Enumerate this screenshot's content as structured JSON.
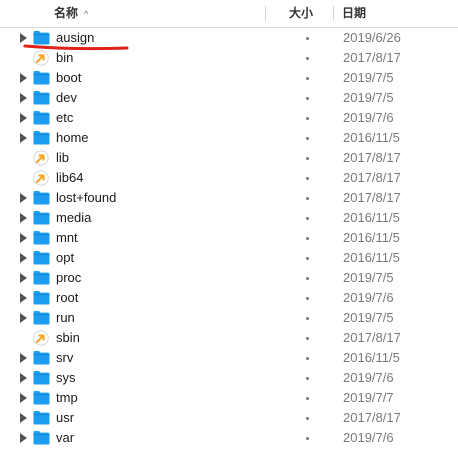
{
  "columns": {
    "name": "名称",
    "size": "大小",
    "date": "日期"
  },
  "rows": [
    {
      "name": "ausign",
      "type": "folder",
      "size": "•",
      "date": "2019/6/26"
    },
    {
      "name": "bin",
      "type": "link",
      "size": "•",
      "date": "2017/8/17"
    },
    {
      "name": "boot",
      "type": "folder",
      "size": "•",
      "date": "2019/7/5"
    },
    {
      "name": "dev",
      "type": "folder",
      "size": "•",
      "date": "2019/7/5"
    },
    {
      "name": "etc",
      "type": "folder",
      "size": "•",
      "date": "2019/7/6"
    },
    {
      "name": "home",
      "type": "folder",
      "size": "•",
      "date": "2016/11/5"
    },
    {
      "name": "lib",
      "type": "link",
      "size": "•",
      "date": "2017/8/17"
    },
    {
      "name": "lib64",
      "type": "link",
      "size": "•",
      "date": "2017/8/17"
    },
    {
      "name": "lost+found",
      "type": "folder",
      "size": "•",
      "date": "2017/8/17"
    },
    {
      "name": "media",
      "type": "folder",
      "size": "•",
      "date": "2016/11/5"
    },
    {
      "name": "mnt",
      "type": "folder",
      "size": "•",
      "date": "2016/11/5"
    },
    {
      "name": "opt",
      "type": "folder",
      "size": "•",
      "date": "2016/11/5"
    },
    {
      "name": "proc",
      "type": "folder",
      "size": "•",
      "date": "2019/7/5"
    },
    {
      "name": "root",
      "type": "folder",
      "size": "•",
      "date": "2019/7/6"
    },
    {
      "name": "run",
      "type": "folder",
      "size": "•",
      "date": "2019/7/5"
    },
    {
      "name": "sbin",
      "type": "link",
      "size": "•",
      "date": "2017/8/17"
    },
    {
      "name": "srv",
      "type": "folder",
      "size": "•",
      "date": "2016/11/5"
    },
    {
      "name": "sys",
      "type": "folder",
      "size": "•",
      "date": "2019/7/6"
    },
    {
      "name": "tmp",
      "type": "folder",
      "size": "•",
      "date": "2019/7/7"
    },
    {
      "name": "usr",
      "type": "folder",
      "size": "•",
      "date": "2017/8/17"
    },
    {
      "name": "var",
      "type": "folder",
      "size": "•",
      "date": "2019/7/6"
    }
  ],
  "colors": {
    "folder": "#1b9ef0",
    "link_arrow": "#f5a623",
    "annotation": "#e0201b"
  },
  "icons": {
    "folder": "folder-icon",
    "link": "alias-link-icon",
    "disclosure": "disclosure-triangle-icon",
    "sort": "sort-ascending-icon"
  }
}
